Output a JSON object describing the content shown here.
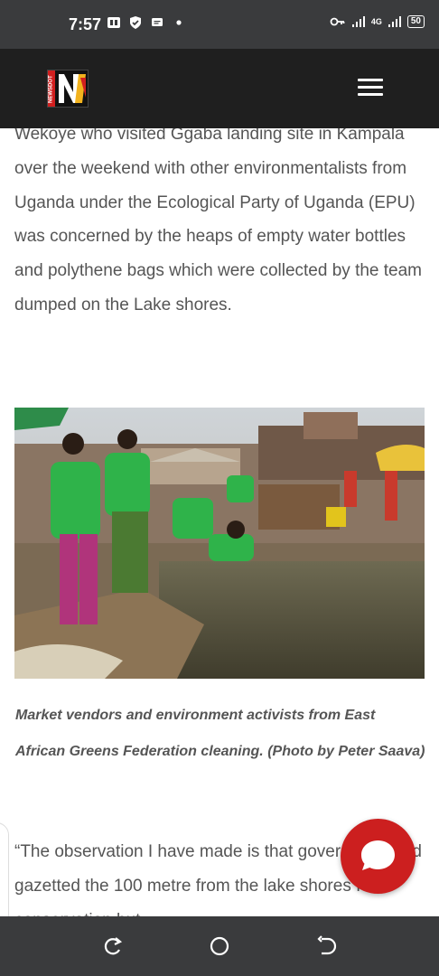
{
  "status_bar": {
    "time": "7:57",
    "network": "4G",
    "battery": "50",
    "icons": [
      "app-icon",
      "shield-check-icon",
      "message-icon",
      "dot-icon",
      "key-icon",
      "signal-icon",
      "signal-icon"
    ]
  },
  "header": {
    "logo_letter": "N",
    "logo_side_text": "NEWSDOT",
    "menu_icon": "hamburger-icon"
  },
  "article": {
    "paragraph": "Wekoye who visited Ggaba landing site in Kampala over the weekend with other environmentalists from Uganda under the Ecological Party of Uganda (EPU) was concerned by the heaps of empty water bottles and polythene bags which were collected by the team dumped on the Lake shores.",
    "image_caption": "Market vendors and environment activists from East African Greens Federation cleaning. (Photo by Peter Saava)",
    "quote_text": "“The observation I have made is that government had gazetted the 100 metre from the lake shores for conservation but"
  },
  "chat": {
    "icon": "chat-bubble-icon"
  },
  "nav_bar": {
    "icons": [
      "back-rotate-icon",
      "home-circle-icon",
      "recents-icon"
    ]
  }
}
